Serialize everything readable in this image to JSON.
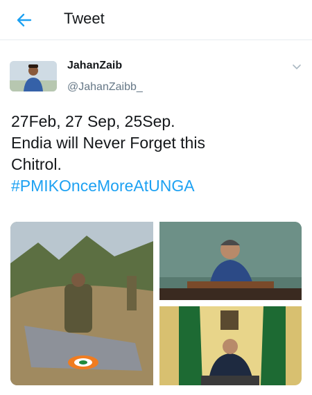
{
  "header": {
    "title": "Tweet",
    "back_icon": "arrow-left-icon",
    "accent_color": "#1da1f2"
  },
  "tweet": {
    "author": {
      "display_name": "JahanZaib",
      "handle": "@JahanZaibb_"
    },
    "menu_icon": "chevron-down-icon",
    "text_lines": [
      "27Feb,  27 Sep,  25Sep.",
      "Endia will Never Forget this",
      "Chitrol."
    ],
    "hashtag": "#PMIKOnceMoreAtUNGA",
    "hashtag_color": "#1da1f2",
    "media": [
      {
        "icon": "photo-soldier-wreckage"
      },
      {
        "icon": "photo-speaker-podium"
      },
      {
        "icon": "photo-speaker-flags"
      }
    ]
  }
}
